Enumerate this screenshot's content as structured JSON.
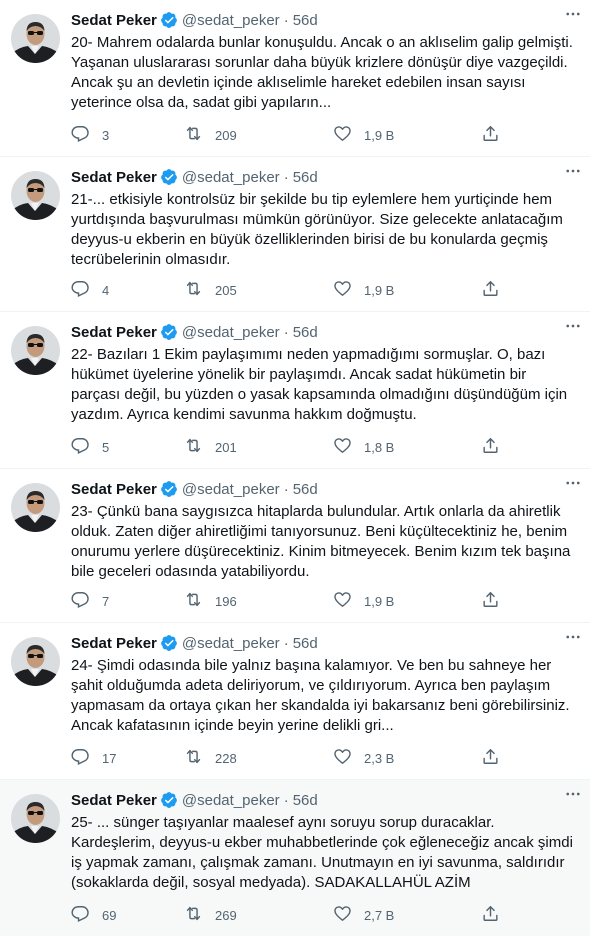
{
  "tweets": [
    {
      "name": "Sedat Peker",
      "handle": "@sedat_peker",
      "time": "56d",
      "text": "20- Mahrem odalarda bunlar konuşuldu. Ancak o an aklıselim galip gelmişti.\nYaşanan uluslararası sorunlar daha büyük krizlere dönüşür diye vazgeçildi.\nAncak şu an devletin içinde aklıselimle hareket edebilen insan sayısı\nyeterince olsa da, sadat gibi yapıların...",
      "replies": "3",
      "retweets": "209",
      "likes": "1,9 B"
    },
    {
      "name": "Sedat Peker",
      "handle": "@sedat_peker",
      "time": "56d",
      "text": "21-... etkisiyle kontrolsüz bir şekilde bu tip eylemlere hem yurtiçinde hem\nyurtdışında başvurulması mümkün görünüyor. Size gelecekte anlatacağım\ndeyyus-u ekberin en büyük özelliklerinden birisi de bu konularda geçmiş\ntecrübelerinin olmasıdır.",
      "replies": "4",
      "retweets": "205",
      "likes": "1,9 B"
    },
    {
      "name": "Sedat Peker",
      "handle": "@sedat_peker",
      "time": "56d",
      "text": "22- Bazıları 1 Ekim paylaşımımı neden yapmadığımı sormuşlar. O, bazı\nhükümet üyelerine yönelik bir paylaşımdı. Ancak sadat hükümetin bir\nparçası değil, bu yüzden o yasak kapsamında olmadığını düşündüğüm için\nyazdım. Ayrıca kendimi savunma hakkım doğmuştu.",
      "replies": "5",
      "retweets": "201",
      "likes": "1,8 B"
    },
    {
      "name": "Sedat Peker",
      "handle": "@sedat_peker",
      "time": "56d",
      "text": "23- Çünkü bana saygısızca hitaplarda bulundular. Artık onlarla da ahiretlik\nolduk. Zaten diğer ahiretliğimi tanıyorsunuz. Beni küçültecektiniz he, benim\nonurumu yerlere düşürecektiniz. Kinim bitmeyecek. Benim kızım tek başına\nbile geceleri odasında yatabiliyordu.",
      "replies": "7",
      "retweets": "196",
      "likes": "1,9 B"
    },
    {
      "name": "Sedat Peker",
      "handle": "@sedat_peker",
      "time": "56d",
      "text": "24- Şimdi odasında bile yalnız başına kalamıyor. Ve ben bu sahneye her\nşahit olduğumda adeta deliriyorum, ve çıldırıyorum. Ayrıca ben paylaşım\nyapmasam da ortaya çıkan her skandalda iyi bakarsanız beni görebilirsiniz.\nAncak kafatasının içinde beyin yerine delikli gri...",
      "replies": "17",
      "retweets": "228",
      "likes": "2,3 B"
    },
    {
      "name": "Sedat Peker",
      "handle": "@sedat_peker",
      "time": "56d",
      "text": "25- ... sünger taşıyanlar maalesef aynı soruyu sorup duracaklar.\nKardeşlerim, deyyus-u ekber muhabbetlerinde çok eğleneceğiz ancak şimdi\niş yapmak zamanı, çalışmak zamanı. Unutmayın en iyi savunma, saldırıdır\n(sokaklarda değil, sosyal medyada). SADAKALLAHÜL AZİM",
      "replies": "69",
      "retweets": "269",
      "likes": "2,7 B"
    }
  ],
  "icons": {
    "verified": "verified-badge-icon",
    "more": "more-icon",
    "reply": "reply-icon",
    "retweet": "retweet-icon",
    "like": "like-icon",
    "share": "share-icon"
  },
  "colors": {
    "text": "#0f1419",
    "secondary": "#536471",
    "verified": "#1d9bf0",
    "highlight_bg": "#f7f9f9",
    "divider": "#eff3f4"
  }
}
